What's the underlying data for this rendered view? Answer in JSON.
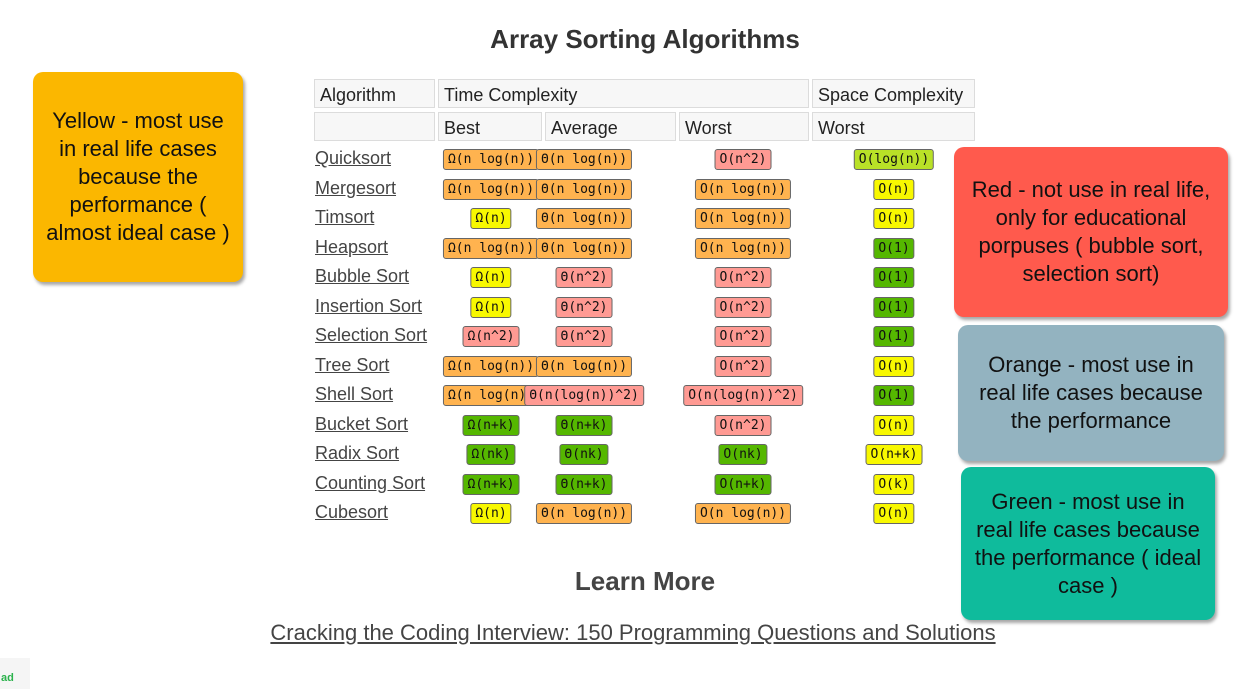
{
  "page": {
    "title": "Array Sorting Algorithms",
    "learn_more": "Learn More",
    "book_link": "Cracking the Coding Interview: 150 Programming Questions and Solutions",
    "ad_label": "ad"
  },
  "header": {
    "row1": [
      "Algorithm",
      "Time Complexity",
      "Space Complexity"
    ],
    "row2": [
      "",
      "Best",
      "Average",
      "Worst",
      "Worst"
    ]
  },
  "colors": {
    "green": "#55b700",
    "light_green": "#b9e127",
    "yellow": "#f8f800",
    "orange": "#ffb34f",
    "red": "#ff9a93"
  },
  "rows": [
    {
      "name": "Quicksort",
      "cells": [
        [
          "Ω(n log(n))",
          "orange"
        ],
        [
          "Θ(n log(n))",
          "orange"
        ],
        [
          "O(n^2)",
          "red"
        ],
        [
          "O(log(n))",
          "light_green"
        ]
      ]
    },
    {
      "name": "Mergesort",
      "cells": [
        [
          "Ω(n log(n))",
          "orange"
        ],
        [
          "Θ(n log(n))",
          "orange"
        ],
        [
          "O(n log(n))",
          "orange"
        ],
        [
          "O(n)",
          "yellow"
        ]
      ]
    },
    {
      "name": "Timsort",
      "cells": [
        [
          "Ω(n)",
          "yellow"
        ],
        [
          "Θ(n log(n))",
          "orange"
        ],
        [
          "O(n log(n))",
          "orange"
        ],
        [
          "O(n)",
          "yellow"
        ]
      ]
    },
    {
      "name": "Heapsort",
      "cells": [
        [
          "Ω(n log(n))",
          "orange"
        ],
        [
          "Θ(n log(n))",
          "orange"
        ],
        [
          "O(n log(n))",
          "orange"
        ],
        [
          "O(1)",
          "green"
        ]
      ]
    },
    {
      "name": "Bubble Sort",
      "cells": [
        [
          "Ω(n)",
          "yellow"
        ],
        [
          "Θ(n^2)",
          "red"
        ],
        [
          "O(n^2)",
          "red"
        ],
        [
          "O(1)",
          "green"
        ]
      ]
    },
    {
      "name": "Insertion Sort",
      "cells": [
        [
          "Ω(n)",
          "yellow"
        ],
        [
          "Θ(n^2)",
          "red"
        ],
        [
          "O(n^2)",
          "red"
        ],
        [
          "O(1)",
          "green"
        ]
      ]
    },
    {
      "name": "Selection Sort",
      "cells": [
        [
          "Ω(n^2)",
          "red"
        ],
        [
          "Θ(n^2)",
          "red"
        ],
        [
          "O(n^2)",
          "red"
        ],
        [
          "O(1)",
          "green"
        ]
      ]
    },
    {
      "name": "Tree Sort",
      "cells": [
        [
          "Ω(n log(n))",
          "orange"
        ],
        [
          "Θ(n log(n))",
          "orange"
        ],
        [
          "O(n^2)",
          "red"
        ],
        [
          "O(n)",
          "yellow"
        ]
      ]
    },
    {
      "name": "Shell Sort",
      "cells": [
        [
          "Ω(n log(n))",
          "orange"
        ],
        [
          "Θ(n(log(n))^2)",
          "red"
        ],
        [
          "O(n(log(n))^2)",
          "red"
        ],
        [
          "O(1)",
          "green"
        ]
      ]
    },
    {
      "name": "Bucket Sort",
      "cells": [
        [
          "Ω(n+k)",
          "green"
        ],
        [
          "Θ(n+k)",
          "green"
        ],
        [
          "O(n^2)",
          "red"
        ],
        [
          "O(n)",
          "yellow"
        ]
      ]
    },
    {
      "name": "Radix Sort",
      "cells": [
        [
          "Ω(nk)",
          "green"
        ],
        [
          "Θ(nk)",
          "green"
        ],
        [
          "O(nk)",
          "green"
        ],
        [
          "O(n+k)",
          "yellow"
        ]
      ]
    },
    {
      "name": "Counting Sort",
      "cells": [
        [
          "Ω(n+k)",
          "green"
        ],
        [
          "Θ(n+k)",
          "green"
        ],
        [
          "O(n+k)",
          "green"
        ],
        [
          "O(k)",
          "yellow"
        ]
      ]
    },
    {
      "name": "Cubesort",
      "cells": [
        [
          "Ω(n)",
          "yellow"
        ],
        [
          "Θ(n log(n))",
          "orange"
        ],
        [
          "O(n log(n))",
          "orange"
        ],
        [
          "O(n)",
          "yellow"
        ]
      ]
    }
  ],
  "notes": {
    "yellow": {
      "text": "Yellow - most use in real life cases because the performance ( almost ideal case )",
      "color": "#fbb700"
    },
    "red": {
      "text": "Red - not use in  real life, only for educational porpuses ( bubble sort, selection sort)",
      "color": "#ff5a4d"
    },
    "orange": {
      "text": "Orange - most use in real life cases because the performance",
      "color": "#93b3c0"
    },
    "green": {
      "text": "Green - most use in real life cases because the performance ( ideal case )",
      "color": "#0fbb9c"
    }
  }
}
